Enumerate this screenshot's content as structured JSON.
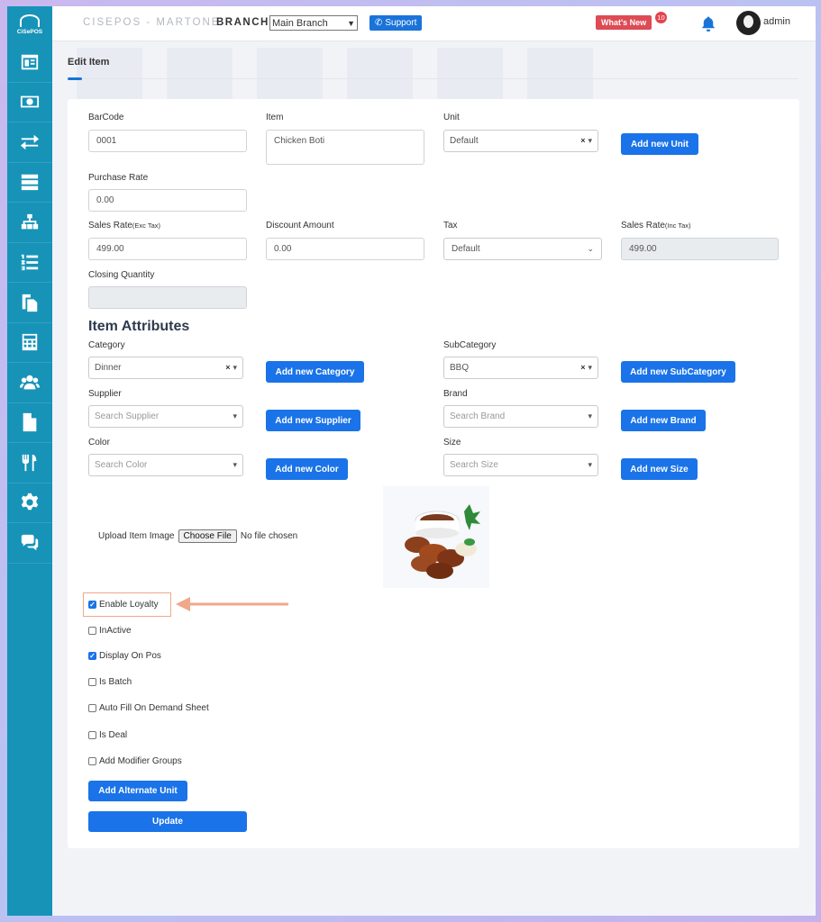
{
  "logo_text": "CiSePOS",
  "sidebar": {
    "icons": [
      "dashboard-icon",
      "money-icon",
      "transfer-icon",
      "server-icon",
      "sitemap-icon",
      "ordered-list-icon",
      "copy-icon",
      "calculator-icon",
      "users-icon",
      "file-icon",
      "utensils-icon",
      "gear-icon",
      "comments-icon"
    ]
  },
  "topbar": {
    "brand": "CISEPOS - MARTONE",
    "branch_label": "BRANCH",
    "branch_value": "Main Branch",
    "support": "Support",
    "whats_new": "What's New",
    "notif_count": "10",
    "user": "admin"
  },
  "page": {
    "title": "Edit Item"
  },
  "form": {
    "barcode": {
      "label": "BarCode",
      "value": "0001"
    },
    "item": {
      "label": "Item",
      "value": "Chicken Boti"
    },
    "unit": {
      "label": "Unit",
      "value": "Default",
      "add": "Add new Unit"
    },
    "purchase_rate": {
      "label": "Purchase Rate",
      "value": "0.00"
    },
    "sales_rate": {
      "label": "Sales Rate",
      "suffix": "(Exc Tax)",
      "value": "499.00"
    },
    "discount": {
      "label": "Discount Amount",
      "value": "0.00"
    },
    "tax": {
      "label": "Tax",
      "value": "Default"
    },
    "sales_rate_inc": {
      "label": "Sales Rate",
      "suffix": "(Inc Tax)",
      "value": "499.00"
    },
    "closing_qty": {
      "label": "Closing Quantity",
      "value": ""
    }
  },
  "attributes": {
    "title": "Item Attributes",
    "category": {
      "label": "Category",
      "value": "Dinner",
      "add": "Add new Category"
    },
    "subcategory": {
      "label": "SubCategory",
      "value": "BBQ",
      "add": "Add new SubCategory"
    },
    "supplier": {
      "label": "Supplier",
      "placeholder": "Search Supplier",
      "add": "Add new Supplier"
    },
    "brand": {
      "label": "Brand",
      "placeholder": "Search Brand",
      "add": "Add new Brand"
    },
    "color": {
      "label": "Color",
      "placeholder": "Search Color",
      "add": "Add new Color"
    },
    "size": {
      "label": "Size",
      "placeholder": "Search Size",
      "add": "Add new Size"
    }
  },
  "upload": {
    "label": "Upload Item Image",
    "button": "Choose File",
    "status": "No file chosen"
  },
  "checkboxes": [
    {
      "label": "Enable Loyalty",
      "checked": true
    },
    {
      "label": "InActive",
      "checked": false
    },
    {
      "label": "Display On Pos",
      "checked": true
    },
    {
      "label": "Is Batch",
      "checked": false
    },
    {
      "label": "Auto Fill On Demand Sheet",
      "checked": false
    },
    {
      "label": "Is Deal",
      "checked": false
    },
    {
      "label": "Add Modifier Groups",
      "checked": false
    }
  ],
  "actions": {
    "alternate_unit": "Add Alternate Unit",
    "update": "Update"
  },
  "colors": {
    "sidebar": "#1793b8",
    "primary": "#1a73e8",
    "highlight": "#f0a78a",
    "danger": "#dd4b54"
  }
}
